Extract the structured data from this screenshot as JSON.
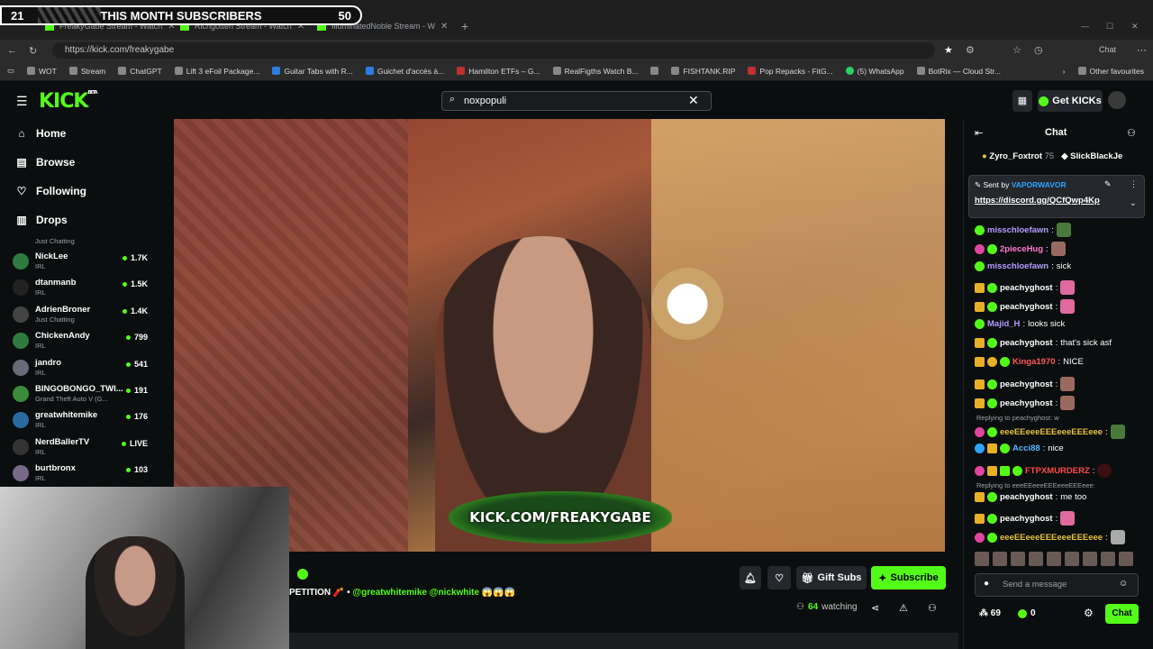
{
  "overlay": {
    "left_num": "21",
    "title": "THIS MONTH SUBSCRIBERS",
    "right_num": "50"
  },
  "browser": {
    "tabs": [
      "FreakyGabe Stream - Watch",
      "Richgotten Stream - Watch",
      "IlluminatedNoble Stream - W"
    ],
    "url": "https://kick.com/freakygabe",
    "chat_btn": "Chat",
    "bookmarks": [
      "WOT",
      "Stream",
      "ChatGPT",
      "Lift 3 eFoil Package...",
      "Guitar Tabs with R...",
      "Guichet d'accès à...",
      "Hamilton ETFs – G...",
      "RealFigths Watch B...",
      "",
      "FISHTANK.RIP",
      "Pop Repacks - FitG...",
      "(5) WhatsApp",
      "BotRix — Cloud Str..."
    ],
    "other_favourites": "Other favourites"
  },
  "header": {
    "logo": "KICK",
    "logo_tag": "BETA",
    "search_value": "noxpopuli",
    "get_kicks": "Get KICKs"
  },
  "sidebar": {
    "nav": [
      {
        "label": "Home",
        "icon": "home-icon"
      },
      {
        "label": "Browse",
        "icon": "browse-icon"
      },
      {
        "label": "Following",
        "icon": "heart-icon"
      },
      {
        "label": "Drops",
        "icon": "drops-icon"
      }
    ],
    "partial_category": "Just Chatting",
    "channels": [
      {
        "name": "NickLee",
        "category": "IRL",
        "viewers": "1.7K"
      },
      {
        "name": "dtanmanb",
        "category": "IRL",
        "viewers": "1.5K"
      },
      {
        "name": "AdrienBroner",
        "category": "Just Chatting",
        "viewers": "1.4K"
      },
      {
        "name": "ChickenAndy",
        "category": "IRL",
        "viewers": "799"
      },
      {
        "name": "jandro",
        "category": "IRL",
        "viewers": "541"
      },
      {
        "name": "BINGOBONGO_TWI...",
        "category": "Grand Theft Auto V (G...",
        "viewers": "191"
      },
      {
        "name": "greatwhitemike",
        "category": "IRL",
        "viewers": "176"
      },
      {
        "name": "NerdBallerTV",
        "category": "IRL",
        "viewers": "LIVE"
      },
      {
        "name": "burtbronx",
        "category": "IRL",
        "viewers": "103"
      }
    ]
  },
  "player": {
    "watermark": "KICK.COM/FREAKYGABE"
  },
  "stream_info": {
    "title_prefix": "PETITION 🧨 • ",
    "title_mentions": "@greatwhitemike @nickwhite",
    "title_suffix": " 😱😱😱",
    "gift_subs": "Gift Subs",
    "subscribe": "Subscribe",
    "watching_count": "64",
    "watching_label": "watching"
  },
  "chat": {
    "title": "Chat",
    "gifters": [
      {
        "name": "Zyro_Foxtrot",
        "count": "75"
      },
      {
        "name": "SlickBlackJe",
        "count": ""
      }
    ],
    "pinned": {
      "sent_by": "Sent by",
      "user": "VAPORWAVOR",
      "link": "https://discord.gg/QCfQwp4Kp"
    },
    "messages": [
      {
        "user": "misschloefawn",
        "text": "",
        "color": "#b49cff"
      },
      {
        "user": "2pieceHug",
        "text": "",
        "color": "#ff7ad0"
      },
      {
        "user": "misschloefawn",
        "text": "sick",
        "color": "#b49cff"
      },
      {
        "user": "peachyghost",
        "text": "",
        "color": "#ffffff"
      },
      {
        "user": "peachyghost",
        "text": "",
        "color": "#ffffff"
      },
      {
        "user": "Majid_H",
        "text": "looks sick",
        "color": "#b49cff"
      },
      {
        "user": "peachyghost",
        "text": "that's sick asf",
        "color": "#ffffff"
      },
      {
        "user": "Kinga1970",
        "text": "NICE",
        "color": "#ff5a5a"
      },
      {
        "user": "peachyghost",
        "text": "",
        "color": "#ffffff"
      },
      {
        "user": "peachyghost",
        "text": "",
        "color": "#ffffff"
      },
      {
        "user": "eeeEEeeeEEEeeeEEEeee",
        "text": "",
        "color": "#e8c341"
      },
      {
        "user": "Acci88",
        "text": "nice",
        "color": "#5ab4ff"
      },
      {
        "user": "FTPXMURDERZ",
        "text": "",
        "color": "#ff4a4a"
      },
      {
        "user": "peachyghost",
        "text": "me too",
        "color": "#ffffff"
      },
      {
        "user": "peachyghost",
        "text": "",
        "color": "#ffffff"
      },
      {
        "user": "eeeEEeeeEEEeeeEEEeee",
        "text": "",
        "color": "#e8c341"
      }
    ],
    "reply_1": "Replying to peachyghost: w",
    "reply_2": "Replying to eeeEEeeeEEEeeeEEEeee:",
    "input_placeholder": "Send a message",
    "kicks": "69",
    "zero": "0",
    "send": "Chat"
  },
  "colors": {
    "accent": "#53fc18",
    "bg": "#0b0e0f"
  }
}
